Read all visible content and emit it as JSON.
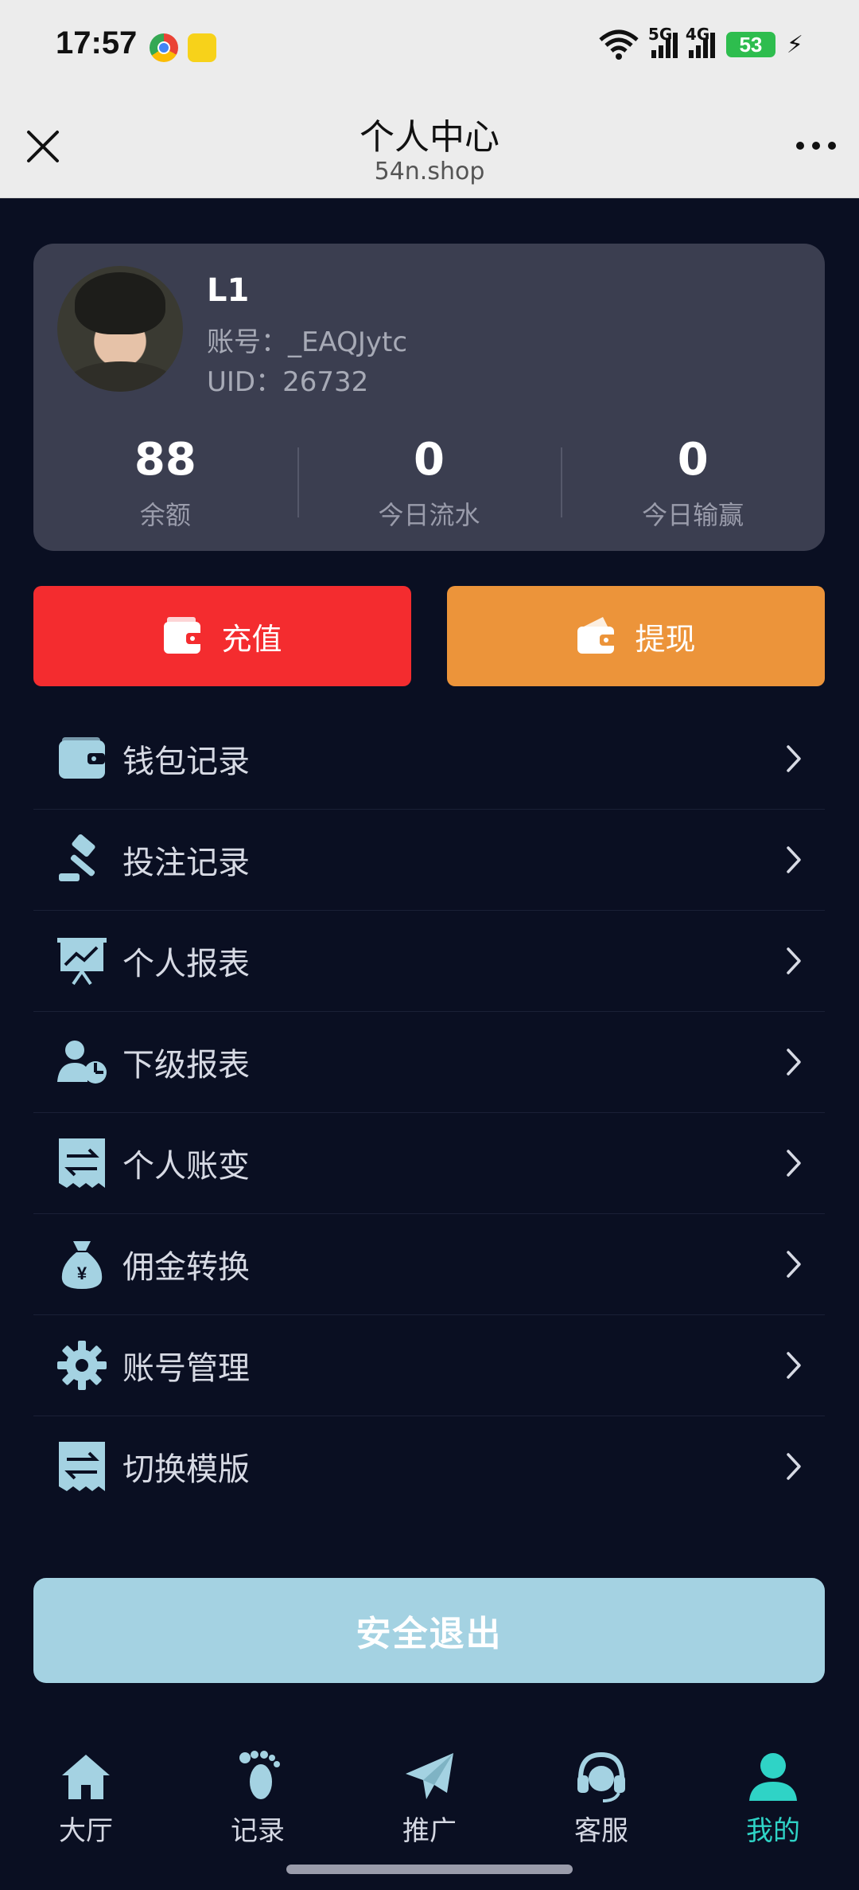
{
  "status_bar": {
    "time": "17:57",
    "net1": "5G",
    "net2": "4G",
    "battery": "53"
  },
  "navbar": {
    "title": "个人中心",
    "subtitle": "54n.shop"
  },
  "profile": {
    "name": "L1",
    "account_label": "账号：",
    "account": "_EAQJytc",
    "uid_label": "UID：",
    "uid": "26732",
    "stats": [
      {
        "value": "88",
        "label": "余额"
      },
      {
        "value": "0",
        "label": "今日流水"
      },
      {
        "value": "0",
        "label": "今日输赢"
      }
    ]
  },
  "actions": {
    "recharge": "充值",
    "withdraw": "提现",
    "recharge_color": "#f42c2f",
    "withdraw_color": "#ec943a"
  },
  "menu": [
    {
      "label": "钱包记录",
      "icon": "wallet-icon"
    },
    {
      "label": "投注记录",
      "icon": "gavel-icon"
    },
    {
      "label": "个人报表",
      "icon": "chart-board-icon"
    },
    {
      "label": "下级报表",
      "icon": "user-pie-icon"
    },
    {
      "label": "个人账变",
      "icon": "exchange-receipt-icon"
    },
    {
      "label": "佣金转换",
      "icon": "money-bag-icon"
    },
    {
      "label": "账号管理",
      "icon": "gear-icon"
    },
    {
      "label": "切换模版",
      "icon": "exchange-receipt-icon"
    }
  ],
  "logout": "安全退出",
  "tabs": [
    {
      "label": "大厅",
      "icon": "home-icon",
      "active": false
    },
    {
      "label": "记录",
      "icon": "footprint-icon",
      "active": false
    },
    {
      "label": "推广",
      "icon": "paper-plane-icon",
      "active": false
    },
    {
      "label": "客服",
      "icon": "headset-icon",
      "active": false
    },
    {
      "label": "我的",
      "icon": "user-icon",
      "active": true
    }
  ],
  "colors": {
    "background": "#0a0f22",
    "card": "#3b3e50",
    "icon": "#a4d2e2",
    "active_tab": "#2fd3c6",
    "logout": "#a4d2e2"
  }
}
